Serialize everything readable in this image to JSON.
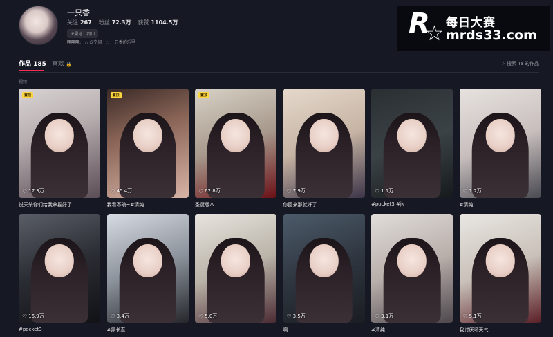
{
  "profile": {
    "name": "一只香",
    "stats": [
      {
        "label": "关注",
        "value": "267"
      },
      {
        "label": "粉丝",
        "value": "72.3万"
      },
      {
        "label": "获赞",
        "value": "1104.5万"
      }
    ],
    "tags": [
      "IP属地：四川"
    ],
    "links_label": "哩哩哩:",
    "links": [
      "@空间",
      "一只香的乐里"
    ]
  },
  "watermark": {
    "title": "每日大赛",
    "url": "mrds33.com",
    "small": "每日大赛"
  },
  "tabs": [
    {
      "label": "作品 185",
      "active": true
    },
    {
      "label": "喜欢",
      "active": false,
      "icon": "lock-icon"
    }
  ],
  "search": {
    "label": "搜索 Ta 的作品",
    "icon": "search-icon"
  },
  "section_label": "视频",
  "colors": {
    "background": "#161823",
    "accent": "#fe2c55",
    "badge": "#fcd53f"
  },
  "videos": [
    {
      "likes": "17.3万",
      "caption": "说天杀你们给我拿捏好了",
      "badge": "置顶",
      "theme": "a"
    },
    {
      "likes": "45.4万",
      "caption": "我看不破~#清纯",
      "badge": "置顶",
      "theme": "b"
    },
    {
      "likes": "62.8万",
      "caption": "圣诞版本",
      "badge": "置顶",
      "theme": "c"
    },
    {
      "likes": "7.9万",
      "caption": "你回来那就好了",
      "badge": "",
      "theme": "d"
    },
    {
      "likes": "1.1万",
      "caption": "#pocket3 #jk",
      "badge": "",
      "theme": "e"
    },
    {
      "likes": "1.2万",
      "caption": "#清纯",
      "badge": "",
      "theme": "f"
    },
    {
      "likes": "16.9万",
      "caption": "#pocket3",
      "badge": "",
      "theme": "g"
    },
    {
      "likes": "3.4万",
      "caption": "#黑长直",
      "badge": "",
      "theme": "h"
    },
    {
      "likes": "5.0万",
      "caption": "",
      "badge": "",
      "theme": "i"
    },
    {
      "likes": "3.5万",
      "caption": "噢",
      "badge": "",
      "theme": "j"
    },
    {
      "likes": "3.1万",
      "caption": "#清纯",
      "badge": "",
      "theme": "k"
    },
    {
      "likes": "5.1万",
      "caption": "我讨厌坏天气",
      "badge": "",
      "theme": "l"
    }
  ]
}
